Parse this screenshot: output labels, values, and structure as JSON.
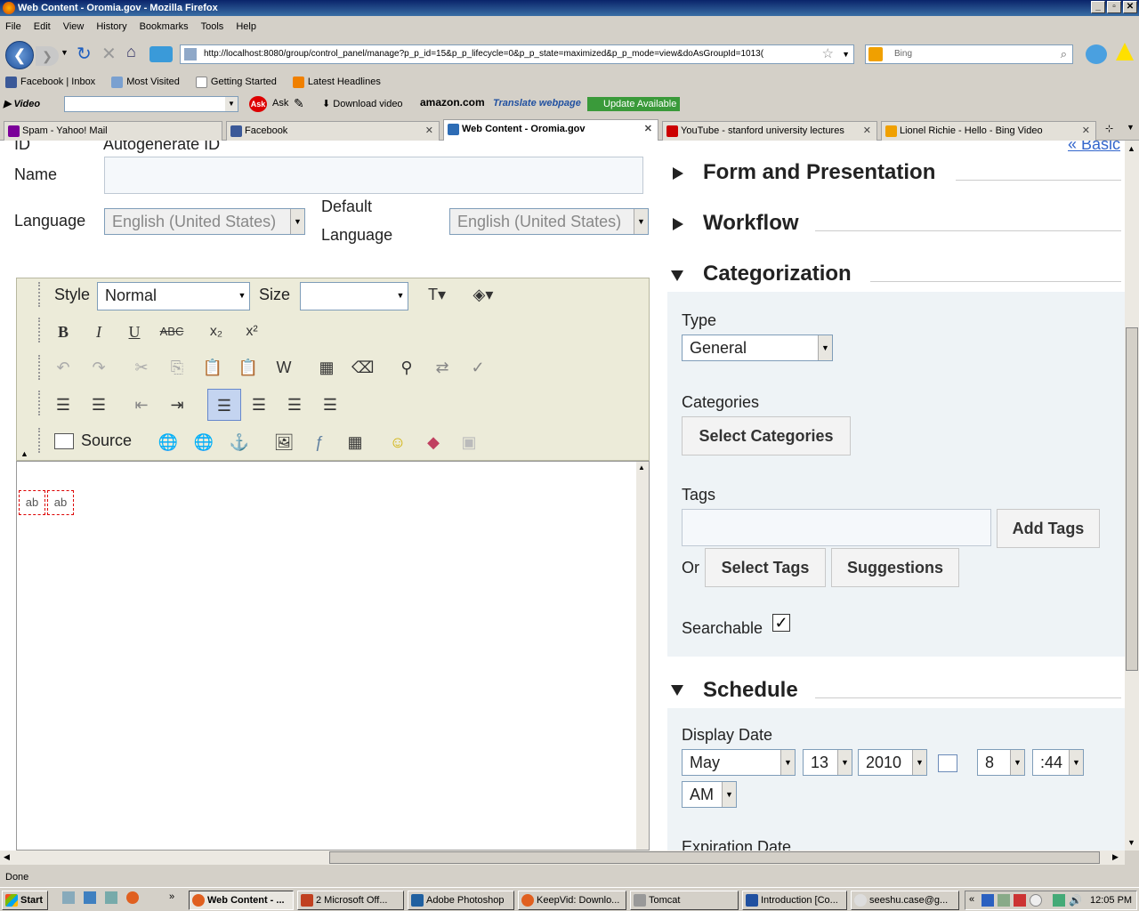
{
  "window": {
    "title": "Web Content - Oromia.gov - Mozilla Firefox"
  },
  "menu": [
    "File",
    "Edit",
    "View",
    "History",
    "Bookmarks",
    "Tools",
    "Help"
  ],
  "nav": {
    "url": "http://localhost:8080/group/control_panel/manage?p_p_id=15&p_p_lifecycle=0&p_p_state=maximized&p_p_mode=view&doAsGroupId=1013(",
    "search_placeholder": "Bing"
  },
  "bookmarks": [
    "Facebook | Inbox",
    "Most Visited",
    "Getting Started",
    "Latest Headlines"
  ],
  "toolbar2": {
    "video_label": "Video",
    "ask": "Ask",
    "download": "Download video",
    "amazon": "amazon.com",
    "translate": "Translate webpage",
    "update": "Update Available"
  },
  "tabs": [
    {
      "label": "Spam - Yahoo! Mail",
      "color": "#7b0099"
    },
    {
      "label": "Facebook",
      "color": "#3b5998"
    },
    {
      "label": "Web Content - Oromia.gov",
      "color": "#2d6cb5"
    },
    {
      "label": "YouTube - stanford university lectures",
      "color": "#cc0000"
    },
    {
      "label": "Lionel Richie - Hello - Bing Video",
      "color": "#f0a000"
    }
  ],
  "form": {
    "id_label": "ID",
    "id_value": "Autogenerate ID",
    "name_label": "Name",
    "language_label": "Language",
    "language_value": "English (United States)",
    "default_language_label_1": "Default",
    "default_language_label_2": "Language",
    "default_language_value": "English (United States)",
    "basic_link": "« Basic"
  },
  "editor": {
    "style_label": "Style",
    "style_value": "Normal",
    "size_label": "Size",
    "size_value": "",
    "source_label": "Source",
    "field_a": "ab",
    "field_b": "ab"
  },
  "sections": {
    "form_presentation": "Form and Presentation",
    "workflow": "Workflow",
    "categorization": "Categorization",
    "schedule": "Schedule"
  },
  "categorization": {
    "type_label": "Type",
    "type_value": "General",
    "categories_label": "Categories",
    "select_categories": "Select Categories",
    "tags_label": "Tags",
    "add_tags": "Add Tags",
    "or": "Or",
    "select_tags": "Select Tags",
    "suggestions": "Suggestions",
    "searchable_label": "Searchable"
  },
  "schedule": {
    "display_date_label": "Display Date",
    "month": "May",
    "day": "13",
    "year": "2010",
    "hour": "8",
    "minute": ":44",
    "ampm": "AM",
    "expiration_label": "Expiration Date"
  },
  "status": "Done",
  "taskbar": {
    "start": "Start",
    "items": [
      "Web Content - ...",
      "2 Microsoft Off...",
      "Adobe Photoshop",
      "KeepVid: Downlo...",
      "Tomcat",
      "Introduction [Co...",
      "seeshu.case@g..."
    ],
    "clock": "12:05 PM"
  }
}
